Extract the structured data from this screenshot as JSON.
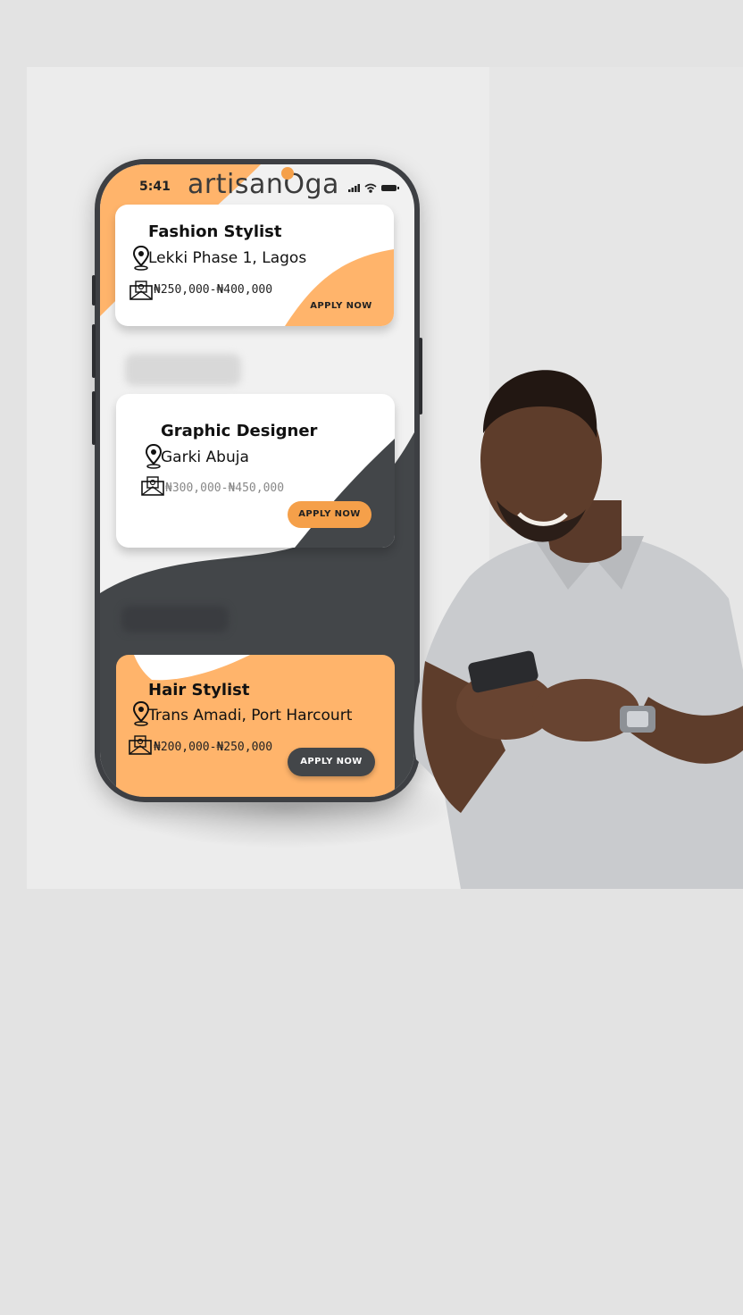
{
  "status": {
    "time": "5:41"
  },
  "brand": {
    "name": "artisanOga",
    "accent": "#f5a04a"
  },
  "colors": {
    "orange": "#ffb46b",
    "dark": "#434649",
    "button_orange": "#f5a04a"
  },
  "jobs": [
    {
      "title": "Fashion Stylist",
      "location": "Lekki Phase 1, Lagos",
      "salary": "₦250,000-₦400,000",
      "cta": "APPLY NOW"
    },
    {
      "title": "Graphic Designer",
      "location": "Garki Abuja",
      "salary": "₦300,000-₦450,000",
      "cta": "APPLY NOW"
    },
    {
      "title": "Hair Stylist",
      "location": "Trans Amadi, Port Harcourt",
      "salary": "₦200,000-₦250,000",
      "cta": "APPLY NOW"
    }
  ],
  "icons": {
    "location": "map-pin-icon",
    "salary": "money-envelope-icon"
  }
}
